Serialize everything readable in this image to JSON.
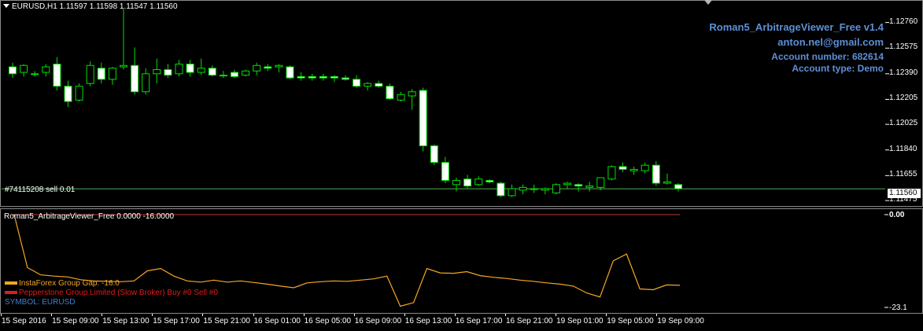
{
  "header": {
    "symbol_line": "EURUSD,H1  1.11597 1.11598 1.11547 1.11560"
  },
  "info_box": {
    "title": "Roman5_ArbitrageViewer_Free v1.4",
    "email": "anton.nel@gmail.com",
    "account_number": "Account number: 682614",
    "account_type": "Account type: Demo",
    "color": "#5d8fd6"
  },
  "order_label": "#74115208 sell 0.01",
  "current_price": "1.11560",
  "price_axis": [
    "1.12760",
    "1.12575",
    "1.12390",
    "1.12205",
    "1.12025",
    "1.11840",
    "1.11655",
    "1.11475"
  ],
  "indicator": {
    "title": "Roman5_ArbitrageViewer_Free 0.0000 -16.0000",
    "axis_top": "0.00",
    "axis_bottom": "-23.1",
    "legend": [
      {
        "text": "InstaForex Group  Gap: -16.0",
        "color": "#f5a623"
      },
      {
        "text": "Pepperstone Group Limited (Slow Broker)  Buy #0  Sell #0",
        "color": "#e01b1b"
      },
      {
        "text": "SYMBOL: EURUSD",
        "color": "#3f7fd6"
      }
    ]
  },
  "time_axis": [
    "15 Sep 2016",
    "15 Sep 09:00",
    "15 Sep 13:00",
    "15 Sep 17:00",
    "15 Sep 21:00",
    "16 Sep 01:00",
    "16 Sep 05:00",
    "16 Sep 09:00",
    "16 Sep 13:00",
    "16 Sep 17:00",
    "16 Sep 21:00",
    "19 Sep 01:00",
    "19 Sep 05:00",
    "19 Sep 09:00"
  ],
  "colors": {
    "bull_body": "#000000",
    "bear_body": "#ffffff",
    "wick": "#00e000",
    "bid_line": "#4caf50",
    "indicator_line": "#f5a623",
    "zero_line": "#c0392b"
  },
  "chart_data": [
    {
      "type": "candlestick",
      "title": "EURUSD,H1",
      "ylim": [
        1.1143,
        1.1286
      ],
      "candles": [
        {
          "o": 1.1244,
          "h": 1.1247,
          "l": 1.1236,
          "c": 1.1239
        },
        {
          "o": 1.124,
          "h": 1.1246,
          "l": 1.1237,
          "c": 1.1245
        },
        {
          "o": 1.1239,
          "h": 1.1241,
          "l": 1.1237,
          "c": 1.1239
        },
        {
          "o": 1.124,
          "h": 1.1246,
          "l": 1.1237,
          "c": 1.1244
        },
        {
          "o": 1.1246,
          "h": 1.1251,
          "l": 1.1227,
          "c": 1.123
        },
        {
          "o": 1.123,
          "h": 1.1234,
          "l": 1.1215,
          "c": 1.1219
        },
        {
          "o": 1.122,
          "h": 1.1232,
          "l": 1.1219,
          "c": 1.123
        },
        {
          "o": 1.1232,
          "h": 1.1248,
          "l": 1.123,
          "c": 1.1245
        },
        {
          "o": 1.1243,
          "h": 1.1247,
          "l": 1.1232,
          "c": 1.1235
        },
        {
          "o": 1.1235,
          "h": 1.1244,
          "l": 1.1231,
          "c": 1.1243
        },
        {
          "o": 1.1244,
          "h": 1.1286,
          "l": 1.1242,
          "c": 1.1245
        },
        {
          "o": 1.1245,
          "h": 1.1258,
          "l": 1.1224,
          "c": 1.1226
        },
        {
          "o": 1.1226,
          "h": 1.1243,
          "l": 1.1224,
          "c": 1.1239
        },
        {
          "o": 1.1239,
          "h": 1.125,
          "l": 1.1232,
          "c": 1.1242
        },
        {
          "o": 1.1242,
          "h": 1.1246,
          "l": 1.1236,
          "c": 1.1238
        },
        {
          "o": 1.1239,
          "h": 1.1249,
          "l": 1.1237,
          "c": 1.1246
        },
        {
          "o": 1.1246,
          "h": 1.1249,
          "l": 1.1237,
          "c": 1.124
        },
        {
          "o": 1.124,
          "h": 1.125,
          "l": 1.1238,
          "c": 1.1243
        },
        {
          "o": 1.1243,
          "h": 1.1245,
          "l": 1.1237,
          "c": 1.1238
        },
        {
          "o": 1.1238,
          "h": 1.1241,
          "l": 1.1236,
          "c": 1.1238
        },
        {
          "o": 1.124,
          "h": 1.1242,
          "l": 1.1236,
          "c": 1.1237
        },
        {
          "o": 1.1238,
          "h": 1.1242,
          "l": 1.1237,
          "c": 1.1241
        },
        {
          "o": 1.1241,
          "h": 1.1247,
          "l": 1.1238,
          "c": 1.1245
        },
        {
          "o": 1.1244,
          "h": 1.1246,
          "l": 1.1241,
          "c": 1.1243
        },
        {
          "o": 1.1244,
          "h": 1.1246,
          "l": 1.124,
          "c": 1.1245
        },
        {
          "o": 1.1244,
          "h": 1.1245,
          "l": 1.1235,
          "c": 1.1236
        },
        {
          "o": 1.1237,
          "h": 1.124,
          "l": 1.1234,
          "c": 1.1236
        },
        {
          "o": 1.1237,
          "h": 1.1239,
          "l": 1.1234,
          "c": 1.1236
        },
        {
          "o": 1.1237,
          "h": 1.1239,
          "l": 1.1234,
          "c": 1.1236
        },
        {
          "o": 1.1237,
          "h": 1.1238,
          "l": 1.1233,
          "c": 1.1236
        },
        {
          "o": 1.1236,
          "h": 1.1238,
          "l": 1.1234,
          "c": 1.1235
        },
        {
          "o": 1.1235,
          "h": 1.1238,
          "l": 1.1229,
          "c": 1.123
        },
        {
          "o": 1.123,
          "h": 1.1233,
          "l": 1.1227,
          "c": 1.1232
        },
        {
          "o": 1.1232,
          "h": 1.1234,
          "l": 1.1229,
          "c": 1.123
        },
        {
          "o": 1.123,
          "h": 1.1232,
          "l": 1.122,
          "c": 1.1221
        },
        {
          "o": 1.122,
          "h": 1.1226,
          "l": 1.1219,
          "c": 1.1224
        },
        {
          "o": 1.1223,
          "h": 1.1228,
          "l": 1.1213,
          "c": 1.1226
        },
        {
          "o": 1.1227,
          "h": 1.1229,
          "l": 1.1183,
          "c": 1.1187
        },
        {
          "o": 1.1187,
          "h": 1.1188,
          "l": 1.1173,
          "c": 1.1175
        },
        {
          "o": 1.1175,
          "h": 1.1179,
          "l": 1.116,
          "c": 1.1162
        },
        {
          "o": 1.1159,
          "h": 1.1164,
          "l": 1.1154,
          "c": 1.1162
        },
        {
          "o": 1.1163,
          "h": 1.1166,
          "l": 1.1156,
          "c": 1.1158
        },
        {
          "o": 1.1159,
          "h": 1.1165,
          "l": 1.1158,
          "c": 1.1163
        },
        {
          "o": 1.1162,
          "h": 1.1163,
          "l": 1.116,
          "c": 1.1161
        },
        {
          "o": 1.116,
          "h": 1.1161,
          "l": 1.115,
          "c": 1.1151
        },
        {
          "o": 1.1151,
          "h": 1.1159,
          "l": 1.115,
          "c": 1.1156
        },
        {
          "o": 1.1155,
          "h": 1.1159,
          "l": 1.1152,
          "c": 1.1157
        },
        {
          "o": 1.1156,
          "h": 1.1159,
          "l": 1.1153,
          "c": 1.1156
        },
        {
          "o": 1.1155,
          "h": 1.1157,
          "l": 1.1152,
          "c": 1.1156
        },
        {
          "o": 1.1153,
          "h": 1.116,
          "l": 1.1152,
          "c": 1.1159
        },
        {
          "o": 1.1159,
          "h": 1.1161,
          "l": 1.1156,
          "c": 1.116
        },
        {
          "o": 1.1159,
          "h": 1.116,
          "l": 1.1154,
          "c": 1.1158
        },
        {
          "o": 1.1157,
          "h": 1.1161,
          "l": 1.1154,
          "c": 1.1158
        },
        {
          "o": 1.1157,
          "h": 1.1164,
          "l": 1.1155,
          "c": 1.1164
        },
        {
          "o": 1.1163,
          "h": 1.1173,
          "l": 1.1162,
          "c": 1.1172
        },
        {
          "o": 1.1172,
          "h": 1.1175,
          "l": 1.1168,
          "c": 1.117
        },
        {
          "o": 1.1169,
          "h": 1.1172,
          "l": 1.1166,
          "c": 1.117
        },
        {
          "o": 1.1169,
          "h": 1.1175,
          "l": 1.1167,
          "c": 1.1173
        },
        {
          "o": 1.1173,
          "h": 1.1176,
          "l": 1.1158,
          "c": 1.116
        },
        {
          "o": 1.116,
          "h": 1.1167,
          "l": 1.1159,
          "c": 1.1161
        },
        {
          "o": 1.1159,
          "h": 1.116,
          "l": 1.1154,
          "c": 1.1156
        }
      ],
      "bid_line": 1.1156
    },
    {
      "type": "line",
      "title": "Roman5_ArbitrageViewer_Free 0.0000 -16.0000",
      "ylim": [
        -23.1,
        0.0
      ],
      "series": [
        {
          "name": "InstaForex Group  Gap: -16.0",
          "values": [
            0.0,
            -13.2,
            -15.0,
            -15.3,
            -15.5,
            -16.2,
            -16.5,
            -16.6,
            -16.7,
            -16.5,
            -14.0,
            -13.4,
            -15.3,
            -16.5,
            -16.8,
            -16.3,
            -16.8,
            -16.5,
            -16.9,
            -17.3,
            -17.8,
            -18.2,
            -17.0,
            -16.7,
            -16.5,
            -16.6,
            -16.3,
            -16.0,
            -15.3,
            -22.8,
            -21.9,
            -13.4,
            -14.5,
            -14.6,
            -14.2,
            -15.2,
            -15.6,
            -15.9,
            -16.3,
            -16.6,
            -17.0,
            -17.3,
            -17.8,
            -19.5,
            -20.5,
            -11.5,
            -9.8,
            -18.5,
            -18.7,
            -17.5,
            -17.6
          ]
        }
      ]
    }
  ]
}
